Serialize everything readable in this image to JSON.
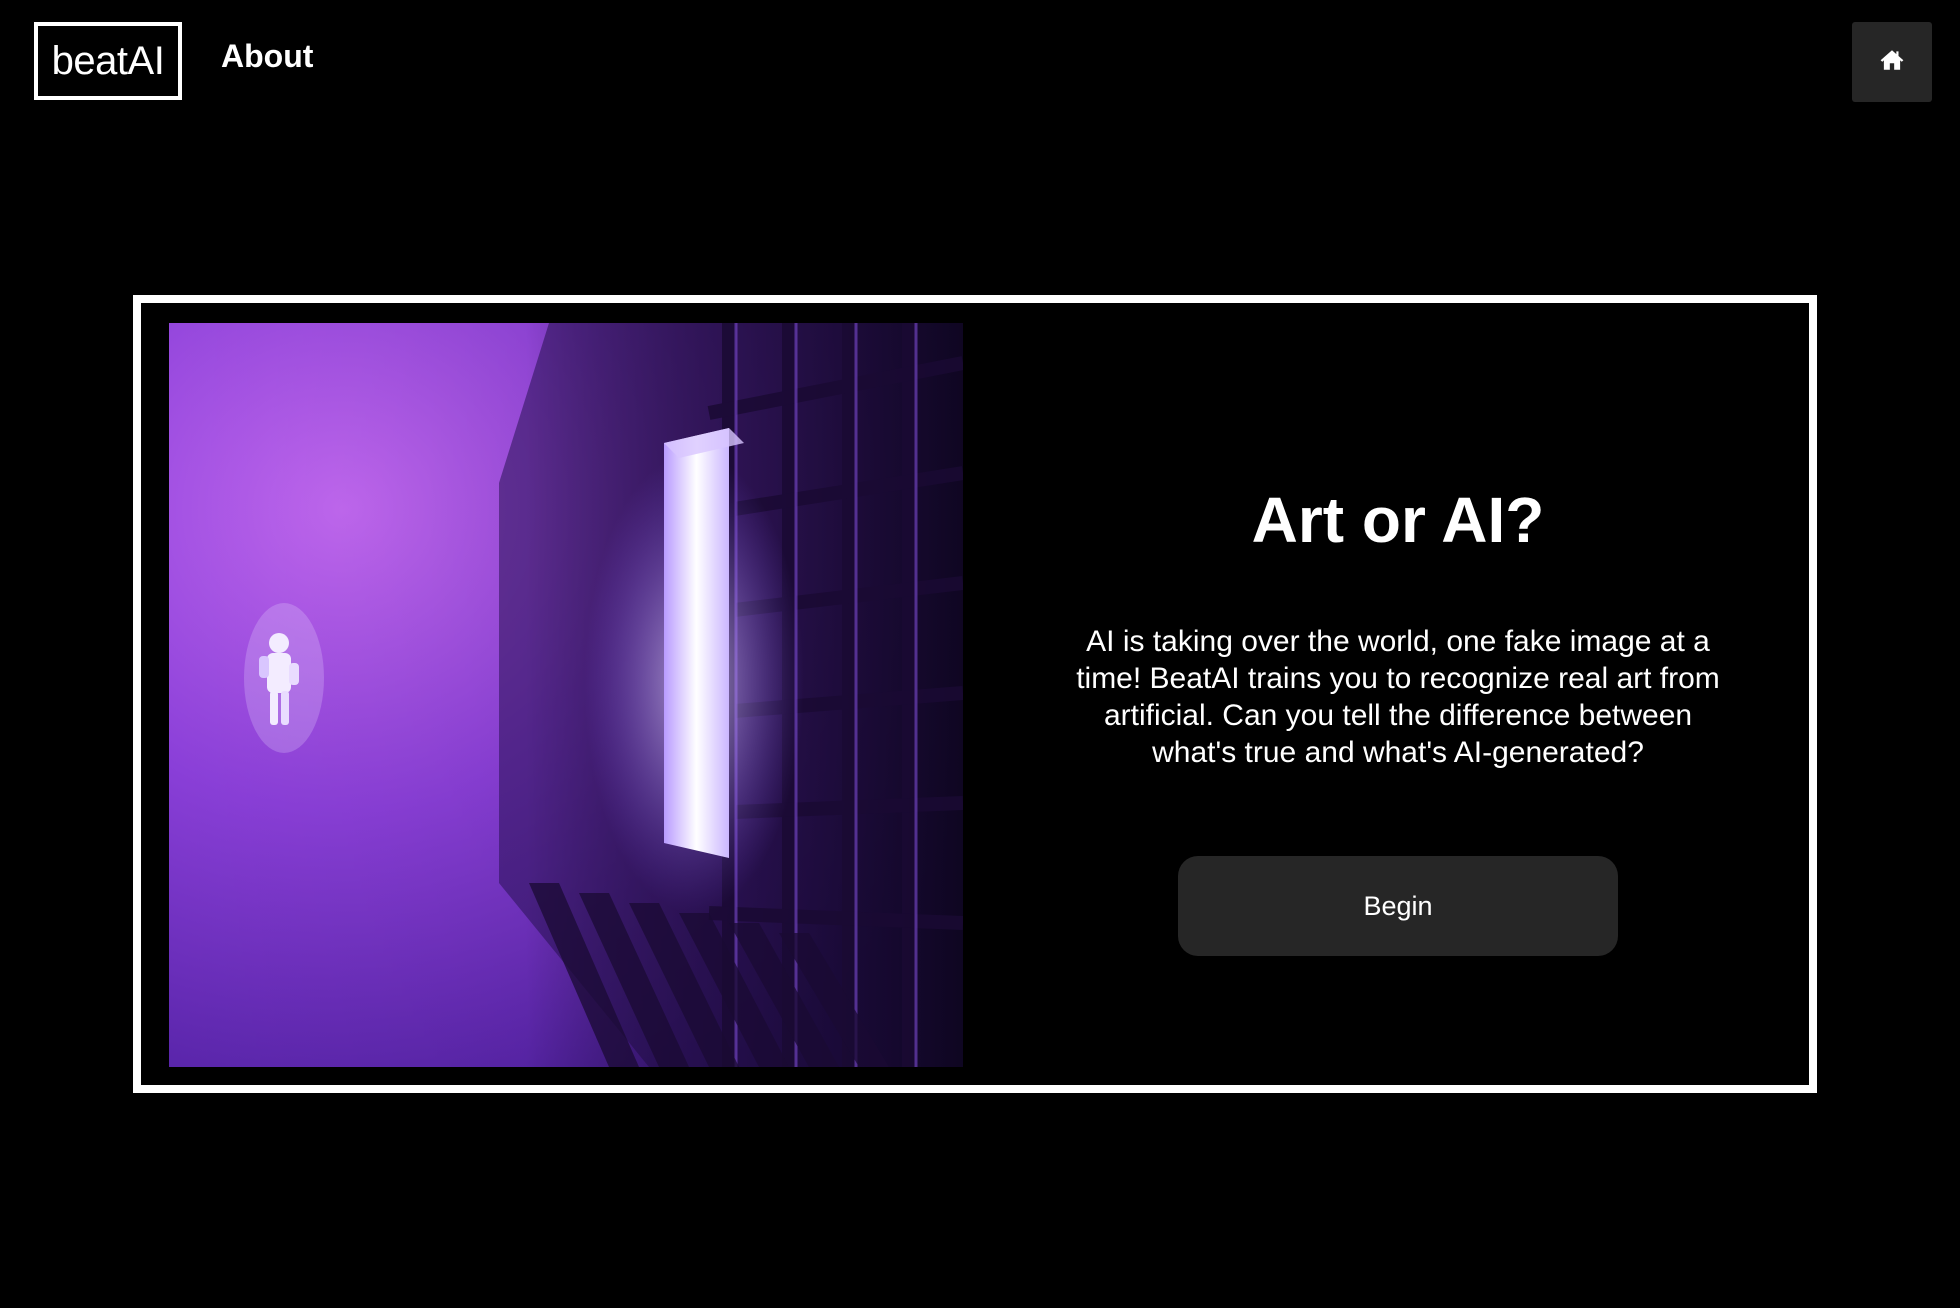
{
  "nav": {
    "logo_text": "beatAI",
    "about_label": "About",
    "home_icon": "home-icon"
  },
  "hero": {
    "title": "Art or AI?",
    "description": "AI is taking over the world, one fake image at a time! BeatAI trains you to recognize real art from artificial. Can you tell the difference between what's true and what's AI-generated?",
    "begin_label": "Begin",
    "image_alt": "Astronaut floating in a purple-lit corridor"
  },
  "colors": {
    "background": "#000000",
    "text": "#ffffff",
    "button": "#262626",
    "art_accent": "#9b4de0"
  }
}
